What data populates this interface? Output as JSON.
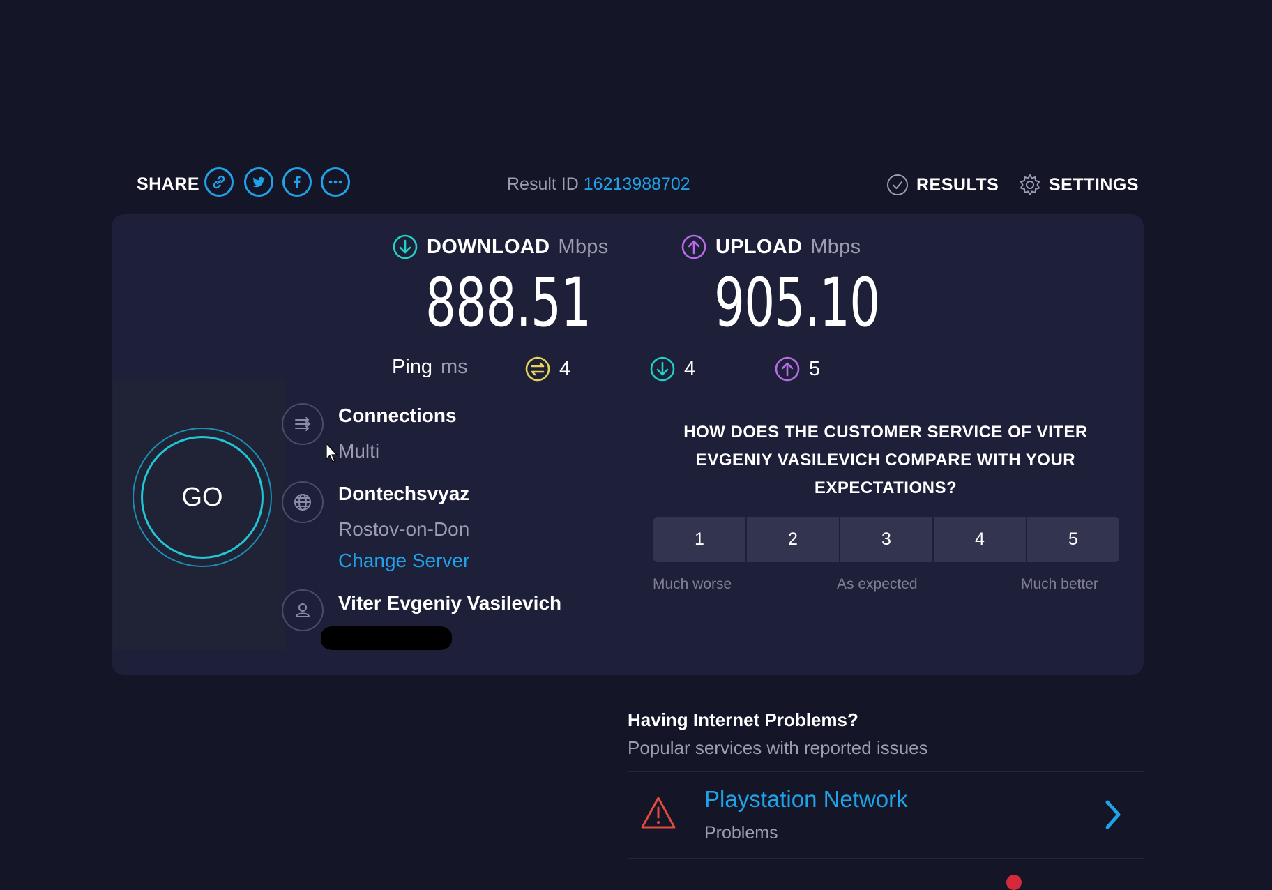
{
  "header": {
    "share_label": "SHARE",
    "share_icons": [
      "link-icon",
      "twitter-icon",
      "facebook-icon",
      "more-icon"
    ],
    "result_label": "Result ID",
    "result_id": "16213988702",
    "results_label": "RESULTS",
    "settings_label": "SETTINGS"
  },
  "download": {
    "label": "DOWNLOAD",
    "unit": "Mbps",
    "value": "888.51"
  },
  "upload": {
    "label": "UPLOAD",
    "unit": "Mbps",
    "value": "905.10"
  },
  "ping": {
    "label": "Ping",
    "unit": "ms",
    "idle": "4",
    "download": "4",
    "upload": "5"
  },
  "go_button": {
    "label": "GO"
  },
  "connections": {
    "title": "Connections",
    "value": "Multi"
  },
  "server": {
    "name": "Dontechsvyaz",
    "location": "Rostov-on-Don",
    "change_label": "Change Server"
  },
  "provider": {
    "name": "Viter Evgeniy Vasilevich"
  },
  "survey": {
    "question": "HOW DOES THE CUSTOMER SERVICE OF VITER EVGENIY VASILEVICH COMPARE WITH YOUR EXPECTATIONS?",
    "options": [
      "1",
      "2",
      "3",
      "4",
      "5"
    ],
    "low_label": "Much worse",
    "mid_label": "As expected",
    "high_label": "Much better"
  },
  "problems": {
    "title": "Having Internet Problems?",
    "subtitle": "Popular services with reported issues",
    "items": [
      {
        "name": "Playstation Network",
        "status": "Problems"
      }
    ]
  },
  "colors": {
    "background": "#141526",
    "panel": "#1e2039",
    "accent_blue": "#1fa2e8",
    "download_teal": "#1fd2c4",
    "upload_purple": "#b96ae8",
    "ping_yellow": "#e8d35a",
    "warning_red": "#e04a3f"
  }
}
